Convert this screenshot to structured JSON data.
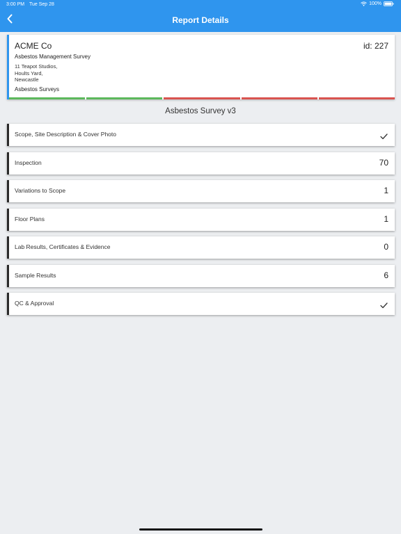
{
  "status": {
    "time": "3:00 PM",
    "date": "Tue Sep 28",
    "battery": "100%"
  },
  "nav": {
    "title": "Report Details",
    "back_icon": "chevron-left-icon"
  },
  "report": {
    "client": "ACME Co",
    "id_label": "id: 227",
    "survey_type": "Asbestos Management Survey",
    "address_line1": "11 Teapot Studios,",
    "address_line2": "Hoults Yard,",
    "address_line3": "Newcastle",
    "category": "Asbestos Surveys",
    "progress_colors": [
      "#5cb85c",
      "#5cb85c",
      "#d9534f",
      "#d9534f",
      "#d9534f"
    ]
  },
  "survey_title": "Asbestos Survey v3",
  "sections": [
    {
      "label": "Scope, Site Description & Cover Photo",
      "count": "",
      "complete": true
    },
    {
      "label": "Inspection",
      "count": "70",
      "complete": false
    },
    {
      "label": "Variations to Scope",
      "count": "1",
      "complete": false
    },
    {
      "label": "Floor Plans",
      "count": "1",
      "complete": false
    },
    {
      "label": "Lab Results, Certificates & Evidence",
      "count": "0",
      "complete": false
    },
    {
      "label": "Sample Results",
      "count": "6",
      "complete": false
    },
    {
      "label": "QC & Approval",
      "count": "",
      "complete": true
    }
  ],
  "colors": {
    "header": "#2f95ee",
    "accent_border": "#2a2a2a",
    "background": "#eceef1"
  }
}
